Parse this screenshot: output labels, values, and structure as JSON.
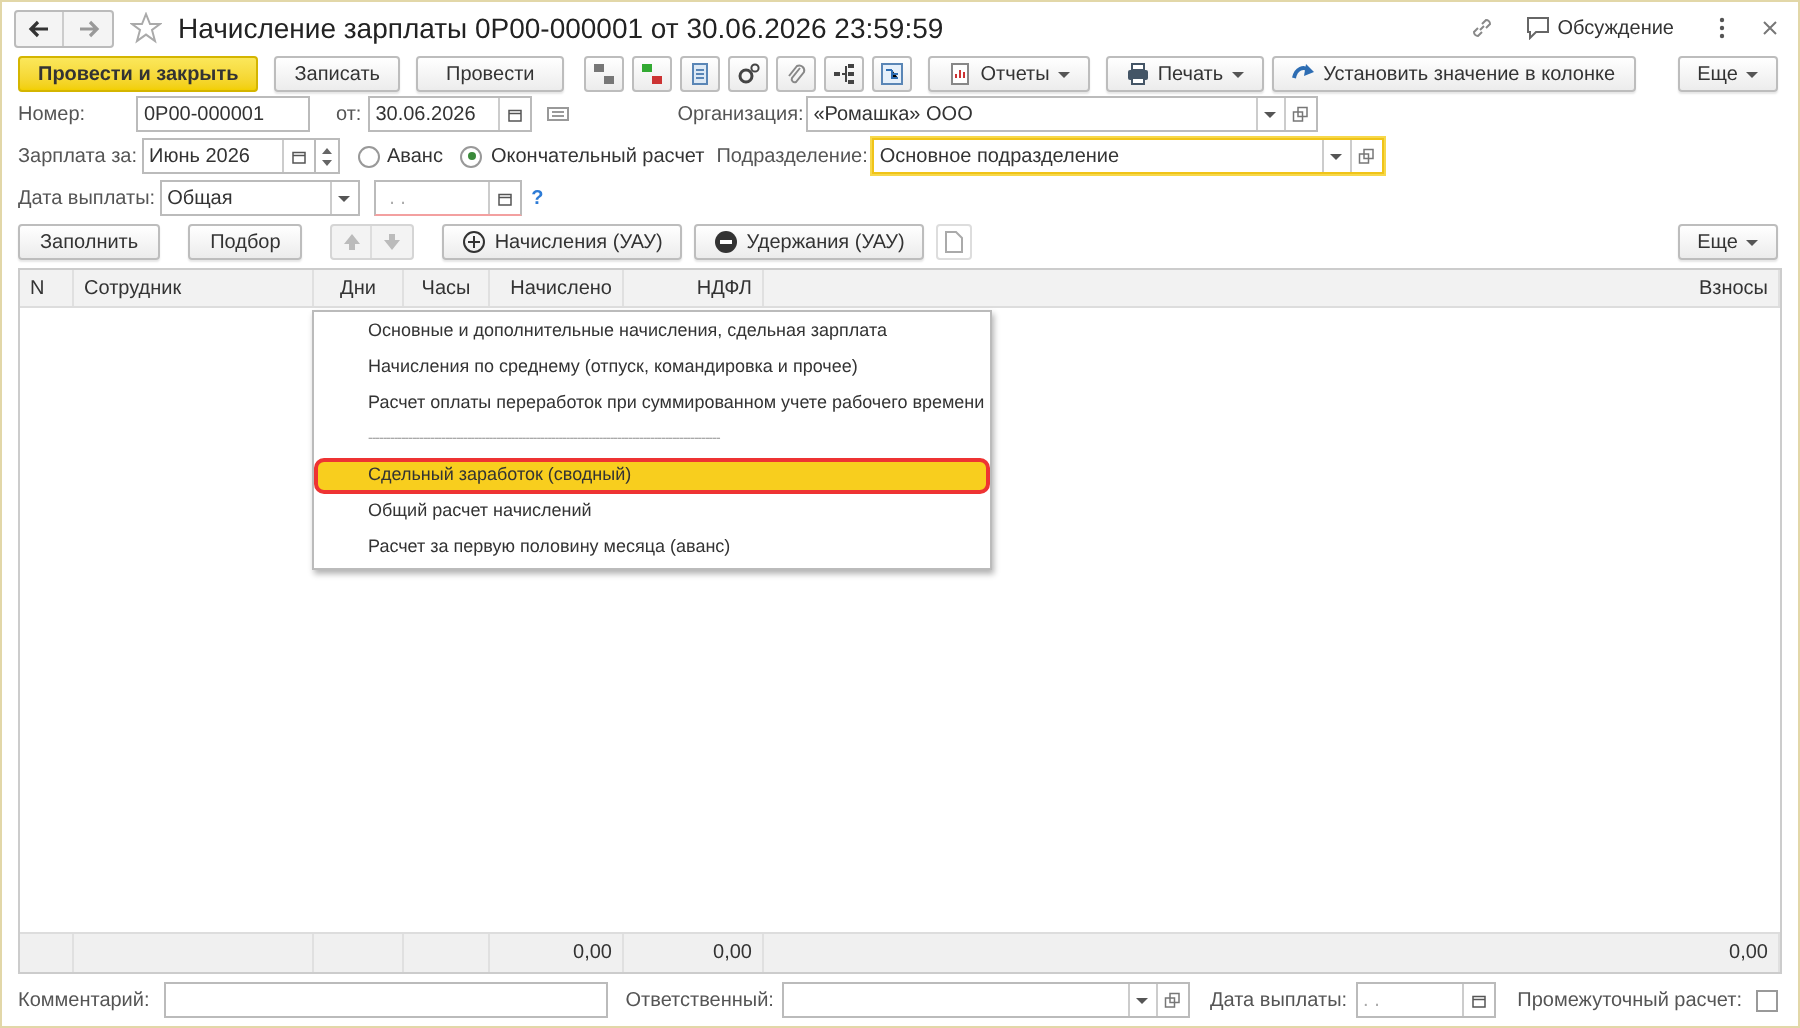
{
  "window": {
    "title": "Начисление зарплаты 0Р00-000001 от 30.06.2026 23:59:59",
    "discussion": "Обсуждение"
  },
  "toolbar": {
    "buttons": [
      {
        "label": "Провести и закрыть",
        "kind": "primary"
      },
      {
        "label": "Записать",
        "kind": "plain"
      },
      {
        "label": "Провести",
        "kind": "plain"
      }
    ],
    "reports": "Отчеты",
    "print": "Печать",
    "set_value": "Установить значение в колонке",
    "more": "Еще"
  },
  "header": {
    "number_label": "Номер:",
    "number": "0Р00-000001",
    "date_label": "от:",
    "date": "30.06.2026",
    "org_label": "Организация:",
    "org": "«Ромашка» ООО",
    "period_label": "Зарплата за:",
    "period": "Июнь 2026",
    "radios": [
      {
        "label": "Аванс",
        "selected": false
      },
      {
        "label": "Окончательный расчет",
        "selected": true
      }
    ],
    "dept_label": "Подразделение:",
    "dept": "Основное подразделение",
    "dept_focused": true,
    "pay_label": "Дата выплаты:",
    "pay": "Общая",
    "pay_date": ". .",
    "help": "?"
  },
  "table_toolbar": {
    "fill": "Заполнить",
    "pick": "Подбор",
    "accruals": "Начисления (УАУ)",
    "deductions": "Удержания (УАУ)",
    "more": "Еще"
  },
  "table": {
    "columns": [
      {
        "label": "N"
      },
      {
        "label": "Сотрудник"
      },
      {
        "label": "Дни"
      },
      {
        "label": "Часы"
      },
      {
        "label": "Начислено",
        "total": "0,00"
      },
      {
        "label": "НДФЛ",
        "total": "0,00"
      },
      {
        "label": "Взносы",
        "total": "0,00"
      }
    ]
  },
  "menu": [
    {
      "kind": "item",
      "label": "Основные и дополнительные начисления, сдельная зарплата",
      "selected": false
    },
    {
      "kind": "item",
      "label": "Начисления по среднему (отпуск, командировка и прочее)",
      "selected": false
    },
    {
      "kind": "item",
      "label": "Расчет оплаты переработок при суммированном учете рабочего времени",
      "selected": false
    },
    {
      "kind": "separator",
      "label": "------------------------------------------------------------------------------------------------",
      "selected": false
    },
    {
      "kind": "item",
      "label": "Сдельный заработок (сводный)",
      "selected": true
    },
    {
      "kind": "item",
      "label": "Общий расчет начислений",
      "selected": false
    },
    {
      "kind": "item",
      "label": "Расчет за первую половину месяца (аванс)",
      "selected": false
    }
  ],
  "footer": {
    "comment_label": "Комментарий:",
    "responsible_label": "Ответственный:",
    "pay_date_label": "Дата выплаты:",
    "pay_date": ". .",
    "interim_label": "Промежуточный расчет:",
    "interim_checked": false
  }
}
